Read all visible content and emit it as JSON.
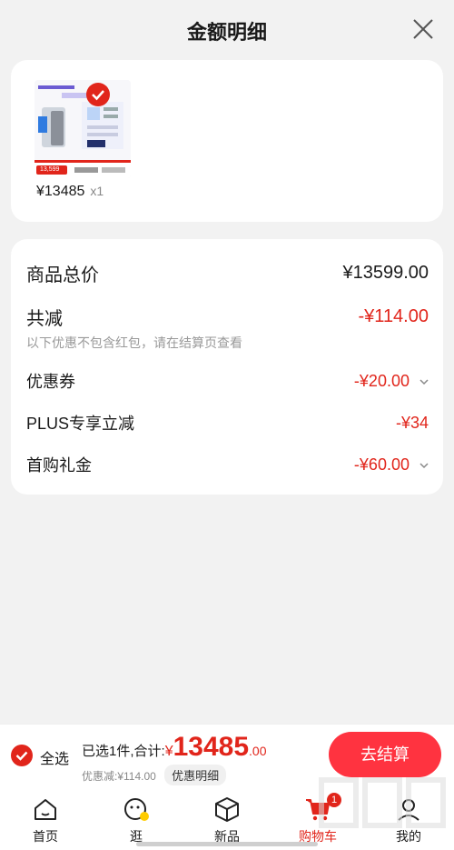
{
  "header": {
    "title": "金额明细"
  },
  "product": {
    "price": "¥13485",
    "qty": "x1",
    "thumb_caption": "13,599"
  },
  "summary": {
    "total_label": "商品总价",
    "total_value": "¥13599.00",
    "reduce_label": "共减",
    "reduce_value": "-¥114.00",
    "reduce_note": "以下优惠不包含红包，请在结算页查看",
    "items": [
      {
        "label": "优惠券",
        "value": "-¥20.00"
      },
      {
        "label": "PLUS专享立减",
        "value": "-¥34"
      },
      {
        "label": "首购礼金",
        "value": "-¥60.00"
      }
    ]
  },
  "bottom_bar": {
    "select_all": "全选",
    "selected_prefix": "已选1件,合计:",
    "currency": "¥",
    "amount": "13485",
    "decimal": ".00",
    "discount_text": "优惠减:¥114.00",
    "detail_chip": "优惠明细",
    "checkout_label": "去结算"
  },
  "tabbar": {
    "tabs": [
      {
        "label": "首页",
        "icon": "home-icon"
      },
      {
        "label": "逛",
        "icon": "browse-icon"
      },
      {
        "label": "新品",
        "icon": "box-icon"
      },
      {
        "label": "购物车",
        "icon": "cart-icon",
        "badge": "1"
      },
      {
        "label": "我的",
        "icon": "profile-icon"
      }
    ]
  },
  "colors": {
    "accent": "#e1251b",
    "checkout": "#ff3340",
    "background": "#f2f2f2"
  }
}
